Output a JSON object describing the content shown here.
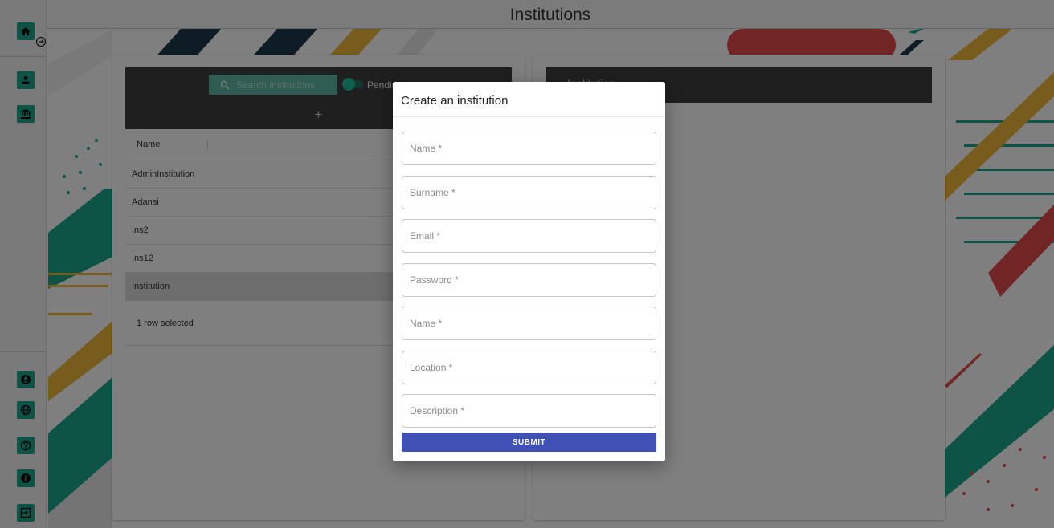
{
  "header": {
    "title": "Institutions"
  },
  "sidebar": {
    "top_icons": [
      "home-icon",
      "user-icon",
      "institution-icon"
    ],
    "bottom_icons": [
      "account-circle-icon",
      "globe-icon",
      "help-icon",
      "info-icon",
      "logout-icon"
    ],
    "accent": "#1aa88f"
  },
  "left_panel": {
    "search_placeholder": "Search institutions",
    "toggle_label": "Pending",
    "add_label": "+",
    "table": {
      "column_name": "Name",
      "rows": [
        "AdminInstitution",
        "Adansi",
        "Ins2",
        "Ins12",
        "Institution"
      ],
      "selected_row": "Institution",
      "footer": "1 row selected"
    }
  },
  "right_panel": {
    "header": "Institution"
  },
  "modal": {
    "title": "Create an institution",
    "fields": [
      {
        "placeholder": "Name *"
      },
      {
        "placeholder": "Surname *"
      },
      {
        "placeholder": "Email *"
      },
      {
        "placeholder": "Password *"
      },
      {
        "placeholder": "Name *"
      },
      {
        "placeholder": "Location *"
      },
      {
        "placeholder": "Description *"
      }
    ],
    "submit_label": "SUBMIT",
    "submit_color": "#3f51b5"
  },
  "colors": {
    "overlay": "rgba(0,0,0,0.5)",
    "toolbar": "#3f3f3f",
    "deco_teal": "#1aa88f",
    "deco_red": "#e24a4a",
    "deco_yellow": "#f0b83a",
    "deco_navy": "#1d3b4a"
  }
}
